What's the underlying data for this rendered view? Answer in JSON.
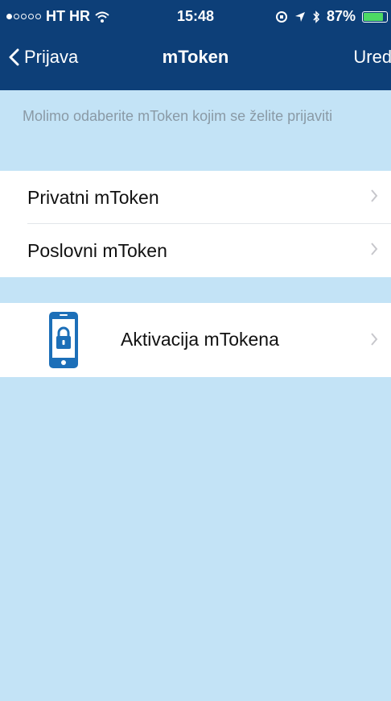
{
  "status_bar": {
    "carrier": "HT HR",
    "time": "15:48",
    "battery": "87%",
    "battery_level": 0.87,
    "signal_bars_filled": 1,
    "signal_bars_total": 5
  },
  "nav": {
    "back_label": "Prijava",
    "title": "mToken",
    "edit_label": "Uredi"
  },
  "hint": "Molimo odaberite mToken kojim se želite prijaviti",
  "tokens": [
    {
      "label": "Privatni mToken"
    },
    {
      "label": "Poslovni mToken"
    }
  ],
  "activation": {
    "label": "Aktivacija mTokena",
    "icon": "phone-lock-icon"
  },
  "colors": {
    "header": "#0d3f78",
    "background": "#c3e3f6",
    "hint_text": "#8a9aa6",
    "chevron": "#c7c7cc",
    "icon_blue": "#1c6fb8"
  }
}
